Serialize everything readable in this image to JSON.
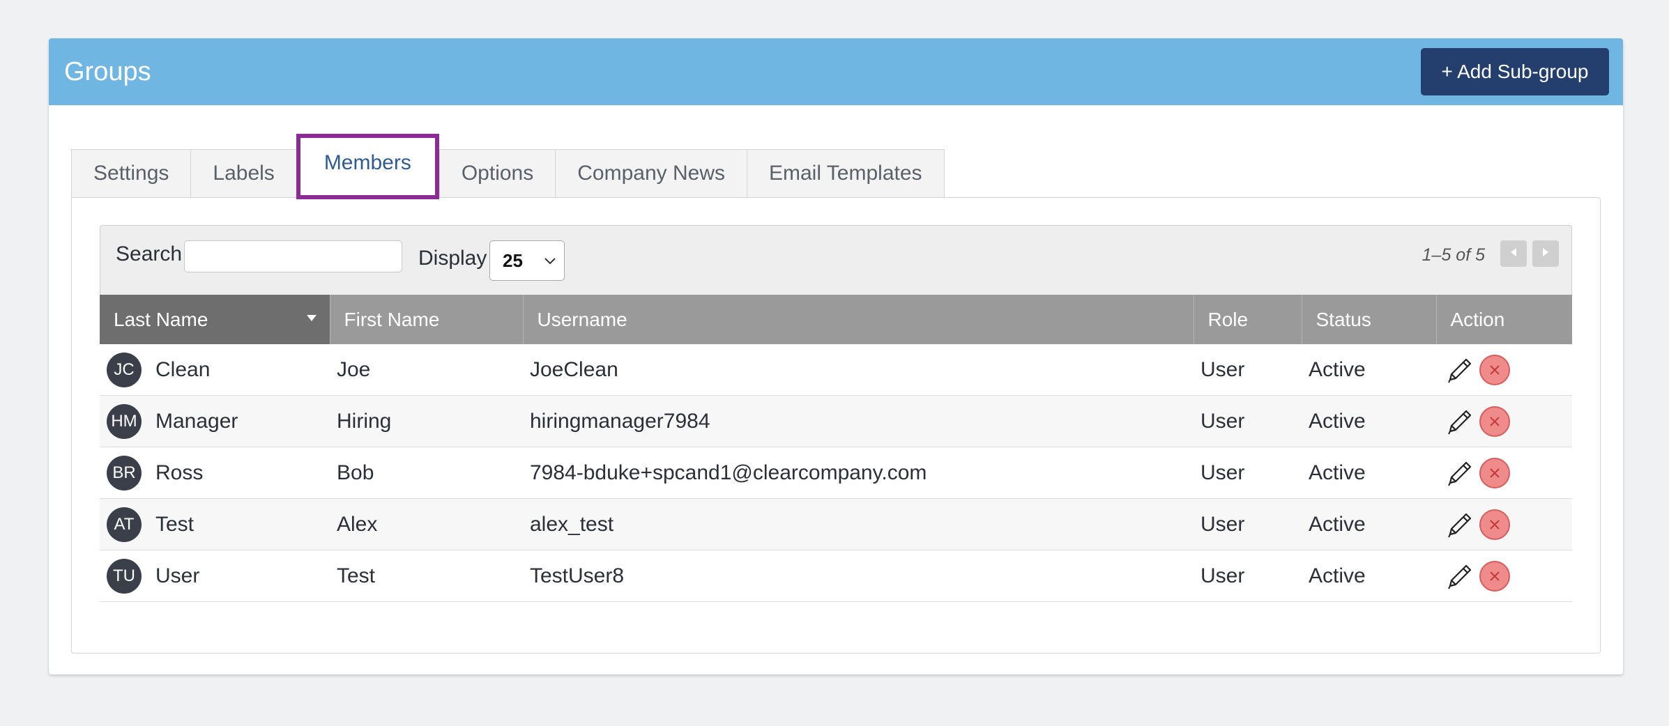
{
  "header": {
    "title": "Groups",
    "add_button_label": "+ Add Sub-group"
  },
  "tabs": [
    {
      "label": "Settings"
    },
    {
      "label": "Labels"
    },
    {
      "label": "Members",
      "active": true
    },
    {
      "label": "Options"
    },
    {
      "label": "Company News"
    },
    {
      "label": "Email Templates"
    }
  ],
  "toolbar": {
    "search_label": "Search",
    "search_value": "",
    "display_label": "Display",
    "display_value": "25",
    "pager_text": "1–5 of 5"
  },
  "columns": [
    "Last Name",
    "First Name",
    "Username",
    "Role",
    "Status",
    "Action"
  ],
  "sorted_column": "Last Name",
  "rows": [
    {
      "initials": "JC",
      "last": "Clean",
      "first": "Joe",
      "username": "JoeClean",
      "role": "User",
      "status": "Active"
    },
    {
      "initials": "HM",
      "last": "Manager",
      "first": "Hiring",
      "username": "hiringmanager7984",
      "role": "User",
      "status": "Active"
    },
    {
      "initials": "BR",
      "last": "Ross",
      "first": "Bob",
      "username": "7984-bduke+spcand1@clearcompany.com",
      "role": "User",
      "status": "Active"
    },
    {
      "initials": "AT",
      "last": "Test",
      "first": "Alex",
      "username": "alex_test",
      "role": "User",
      "status": "Active"
    },
    {
      "initials": "TU",
      "last": "User",
      "first": "Test",
      "username": "TestUser8",
      "role": "User",
      "status": "Active"
    }
  ],
  "colors": {
    "header_bg": "#70b6e3",
    "button_bg": "#243f6e",
    "active_tab_highlight": "#8a2c93",
    "avatar_bg": "#3a3f4a",
    "remove_icon": "#ef8b8b"
  },
  "icons": {
    "sort": "sort-down-icon",
    "edit": "pencil-icon",
    "remove": "remove-circle-icon",
    "prev": "chevron-left-icon",
    "next": "chevron-right-icon",
    "select": "chevron-down-icon"
  }
}
